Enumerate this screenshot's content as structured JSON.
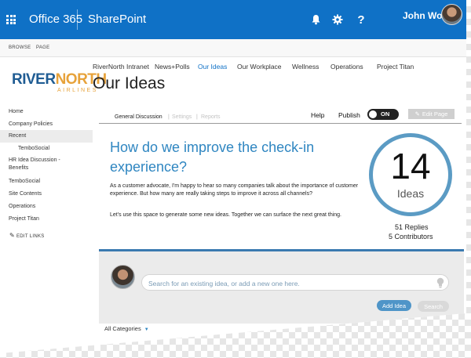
{
  "suite": {
    "app_name": "Office 365",
    "site_name": "SharePoint",
    "user_name": "John Wong"
  },
  "ribbon": {
    "browse": "BROWSE",
    "page": "PAGE"
  },
  "logo": {
    "word1": "RIVER",
    "word2": "NORTH",
    "sub": "AIRLINES"
  },
  "topnav": [
    "RiverNorth Intranet",
    "News+Polls",
    "Our Ideas",
    "Our Workplace",
    "Wellness",
    "Operations",
    "Project Titan"
  ],
  "page_title": "Our Ideas",
  "leftnav": {
    "items": [
      "Home",
      "Company Policies",
      "Recent",
      "TemboSocial",
      "HR Idea Discussion -",
      "Benefits",
      "TemboSocial",
      "Site Contents",
      "Operations",
      "Project Titan"
    ],
    "edit_links": "EDIT LINKS"
  },
  "tabs": {
    "general": "General Discussion",
    "sep1": "|",
    "settings": "Settings",
    "sep2": "|",
    "reports": "Reports"
  },
  "toolbar": {
    "help": "Help",
    "publish": "Publish",
    "toggle_state": "ON",
    "edit_page": "Edit Page"
  },
  "discussion": {
    "question": "How do we improve the check-in experience?",
    "paragraph1": "As a customer advocate, I'm happy to hear so many companies talk about the importance of customer experience. But how many are really taking steps to improve it across all channels?",
    "paragraph2": "Let's use this space to generate some new ideas. Together we can surface the next great thing."
  },
  "stats": {
    "ideas_count": "14",
    "ideas_label": "Ideas",
    "replies": "51 Replies",
    "contributors": "5 Contributors"
  },
  "search": {
    "placeholder": "Search for an existing idea, or add a new one here.",
    "value": "",
    "add_label": "Add Idea",
    "search_label": "Search"
  },
  "filter": {
    "category": "All Categories"
  },
  "colors": {
    "suite_bar": "#0f71c6",
    "accent_blue": "#2f86c1",
    "logo_blue": "#1f5c93",
    "logo_orange": "#e7a23a"
  }
}
